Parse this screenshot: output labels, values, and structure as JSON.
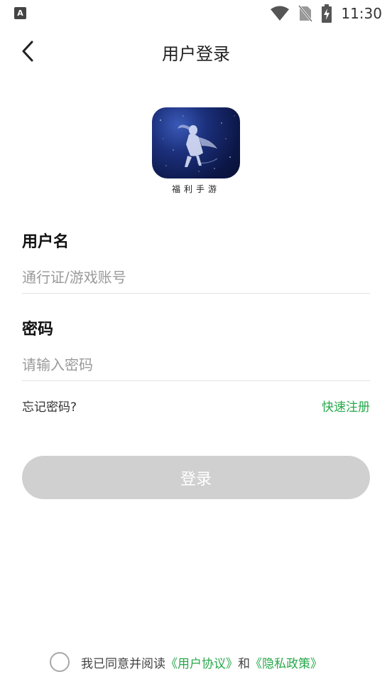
{
  "status_bar": {
    "left_icon": "A",
    "time": "11:30",
    "icons": [
      "wifi-icon",
      "no-sim-icon",
      "battery-charging-icon"
    ]
  },
  "header": {
    "title": "用户登录",
    "back_icon": "chevron-left-icon"
  },
  "logo": {
    "caption": "福利手游"
  },
  "form": {
    "username_label": "用户名",
    "username_placeholder": "通行证/游戏账号",
    "password_label": "密码",
    "password_placeholder": "请输入密码",
    "forgot_label": "忘记密码?",
    "register_label": "快速注册",
    "login_label": "登录"
  },
  "agreement": {
    "prefix": "我已同意并阅读",
    "user_agreement": "《用户协议》",
    "conjunction": "和",
    "privacy_policy": "《隐私政策》"
  },
  "colors": {
    "accent": "#27a84b",
    "button_disabled": "#d0d0d0"
  }
}
